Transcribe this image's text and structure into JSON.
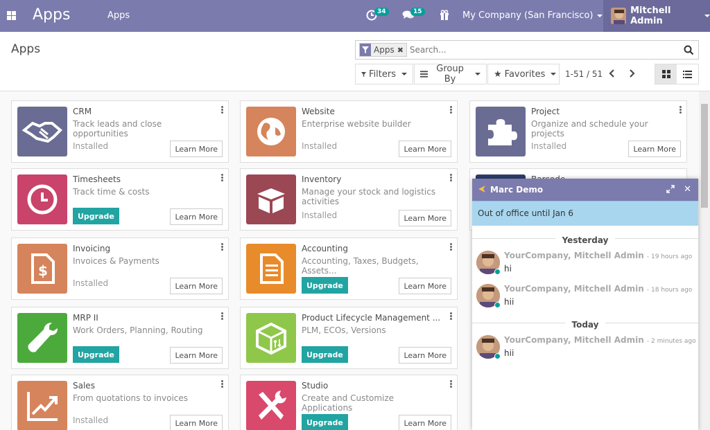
{
  "navbar": {
    "brand": "Apps",
    "menu_apps": "Apps",
    "activity_count": "34",
    "chat_count": "15",
    "company": "My Company (San Francisco)",
    "user": "Mitchell Admin",
    "color": "#7c7bad"
  },
  "control_panel": {
    "title": "Apps",
    "facet": "Apps",
    "search_placeholder": "Search...",
    "filters": "Filters",
    "group_by": "Group By",
    "favorites": "Favorites",
    "pager": "1-51 / 51"
  },
  "apps": [
    {
      "name": "CRM",
      "summary": "Track leads and close opportunities",
      "status": "Installed",
      "learn": "Learn More",
      "icon": "handshake-icon",
      "color": "#6a6c93"
    },
    {
      "name": "Website",
      "summary": "Enterprise website builder",
      "status": "Installed",
      "learn": "Learn More",
      "icon": "globe-icon",
      "color": "#d6845b"
    },
    {
      "name": "Project",
      "summary": "Organize and schedule your projects",
      "status": "Installed",
      "learn": "Learn More",
      "icon": "puzzle-icon",
      "color": "#6a6c93"
    },
    {
      "name": "Timesheets",
      "summary": "Track time & costs",
      "upgrade": "Upgrade",
      "learn": "Learn More",
      "icon": "clock-icon",
      "color": "#c9436b"
    },
    {
      "name": "Inventory",
      "summary": "Manage your stock and logistics activities",
      "status": "Installed",
      "learn": "Learn More",
      "icon": "box-icon",
      "color": "#9b4754"
    },
    {
      "name": "Invoicing",
      "summary": "Invoices & Payments",
      "status": "Installed",
      "learn": "Learn More",
      "icon": "invoice-icon",
      "color": "#d6845b"
    },
    {
      "name": "Accounting",
      "summary": "Accounting, Taxes, Budgets, Assets...",
      "upgrade": "Upgrade",
      "learn": "Learn More",
      "icon": "document-icon",
      "color": "#e88b2b"
    },
    {
      "name": "MRP II",
      "summary": "Work Orders, Planning, Routing",
      "upgrade": "Upgrade",
      "learn": "Learn More",
      "icon": "wrench-icon",
      "color": "#4caa3c"
    },
    {
      "name": "Product Lifecycle Management ...",
      "summary": "PLM, ECOs, Versions",
      "upgrade": "Upgrade",
      "learn": "Learn More",
      "icon": "cube-icon",
      "color": "#8fc74b"
    },
    {
      "name": "Sales",
      "summary": "From quotations to invoices",
      "status": "Installed",
      "learn": "Learn More",
      "icon": "chart-up-icon",
      "color": "#d6845b"
    },
    {
      "name": "Studio",
      "summary": "Create and Customize Applications",
      "upgrade": "Upgrade",
      "learn": "Learn More",
      "icon": "tools-icon",
      "color": "#d9496b"
    }
  ],
  "hidden_card": {
    "name": "Barcode"
  },
  "chat": {
    "name": "Marc Demo",
    "status": "Out of office until Jan 6",
    "yesterday": "Yesterday",
    "today": "Today",
    "messages": [
      {
        "author": "YourCompany, Mitchell Admin",
        "time": "- 19 hours ago",
        "body": "hi"
      },
      {
        "author": "YourCompany, Mitchell Admin",
        "time": "- 18 hours ago",
        "body": "hii"
      },
      {
        "author": "YourCompany, Mitchell Admin",
        "time": "- 2 minutes ago",
        "body": "hii"
      }
    ]
  }
}
